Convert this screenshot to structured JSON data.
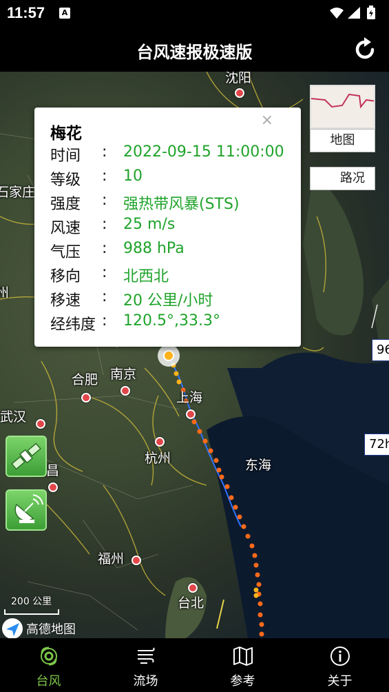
{
  "status_bar": {
    "time": "11:57",
    "notification_badge": "A"
  },
  "app_bar": {
    "title": "台风速报极速版",
    "refresh_icon": "refresh-icon"
  },
  "map": {
    "cities": [
      {
        "id": "shenyang",
        "name": "沈阳"
      },
      {
        "id": "shijiazhuang",
        "name": "石家庄"
      },
      {
        "id": "hefei",
        "name": "合肥"
      },
      {
        "id": "nanjing",
        "name": "南京"
      },
      {
        "id": "shanghai",
        "name": "上海"
      },
      {
        "id": "wuhan",
        "name": "武汉"
      },
      {
        "id": "hangzhou",
        "name": "杭州"
      },
      {
        "id": "nanchang",
        "name": "南昌"
      },
      {
        "id": "fuzhou",
        "name": "福州"
      },
      {
        "id": "taipei",
        "name": "台北"
      },
      {
        "id": "donghai",
        "name": "东海"
      },
      {
        "id": "edge",
        "name": "州"
      }
    ],
    "forecast_labels": {
      "h96": "96",
      "h72": "72h"
    },
    "scale_text": "200 公里",
    "provider_logo": "高德地图",
    "layer_switch": {
      "map_label": "地图",
      "traffic_label": "路况"
    }
  },
  "typhoon_popup": {
    "name": "梅花",
    "close_glyph": "×",
    "separator": ":",
    "fields": [
      {
        "key": "时间",
        "value": "2022-09-15 11:00:00"
      },
      {
        "key": "等级",
        "value": "10"
      },
      {
        "key": "强度",
        "value": "强热带风暴(STS)"
      },
      {
        "key": "风速",
        "value": "25 m/s"
      },
      {
        "key": "气压",
        "value": "988 hPa"
      },
      {
        "key": "移向",
        "value": "北西北"
      },
      {
        "key": "移速",
        "value": "20 公里/小时"
      },
      {
        "key": "经纬度",
        "value": "120.5°,33.3°"
      }
    ]
  },
  "side_buttons": [
    {
      "icon": "satellite-icon"
    },
    {
      "icon": "radar-icon"
    }
  ],
  "tab_bar": {
    "active": "typhoon",
    "tabs": [
      {
        "id": "typhoon",
        "label": "台风",
        "icon": "typhoon-icon"
      },
      {
        "id": "flow",
        "label": "流场",
        "icon": "wind-flow-icon"
      },
      {
        "id": "reference",
        "label": "参考",
        "icon": "map-icon"
      },
      {
        "id": "about",
        "label": "关于",
        "icon": "info-icon"
      }
    ]
  },
  "colors": {
    "accent_green": "#1fa32a",
    "tab_active": "#7ec74a",
    "track_orange": "#ff6a1a",
    "track_yellow": "#ffb31a",
    "city_marker": "#e2464a"
  }
}
